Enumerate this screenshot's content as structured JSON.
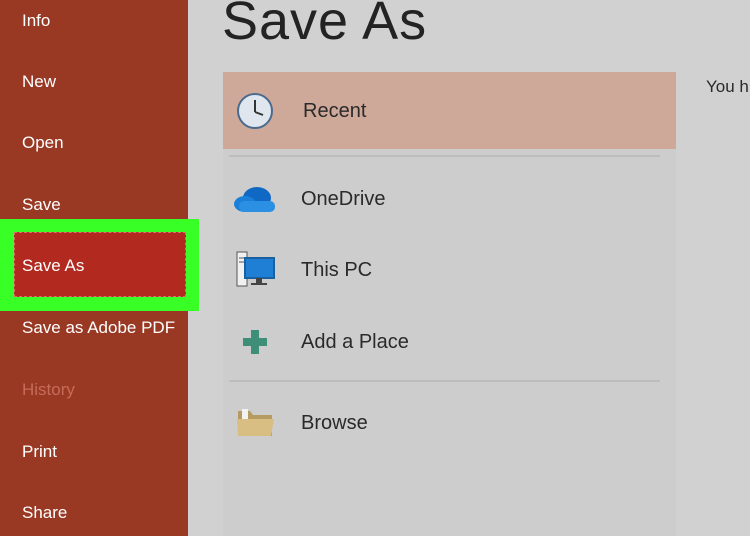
{
  "sidebar": {
    "items": [
      {
        "label": "Info",
        "state": "normal"
      },
      {
        "label": "New",
        "state": "normal"
      },
      {
        "label": "Open",
        "state": "normal"
      },
      {
        "label": "Save",
        "state": "normal"
      },
      {
        "label": "Save As",
        "state": "selected"
      },
      {
        "label": "Save as Adobe PDF",
        "state": "normal"
      },
      {
        "label": "History",
        "state": "disabled"
      },
      {
        "label": "Print",
        "state": "normal"
      },
      {
        "label": "Share",
        "state": "normal"
      }
    ]
  },
  "main": {
    "title": "Save As",
    "locations": [
      {
        "label": "Recent",
        "icon": "clock-icon",
        "selected": true
      },
      {
        "label": "OneDrive",
        "icon": "cloud-icon"
      },
      {
        "label": "This PC",
        "icon": "computer-icon"
      },
      {
        "label": "Add a Place",
        "icon": "plus-icon"
      },
      {
        "label": "Browse",
        "icon": "folder-icon"
      }
    ],
    "right_text": "You h"
  },
  "colors": {
    "sidebar_bg": "#993924",
    "selected_item": "#b22a1f",
    "highlight_box": "#38ff26",
    "recent_bg": "#cea999"
  }
}
